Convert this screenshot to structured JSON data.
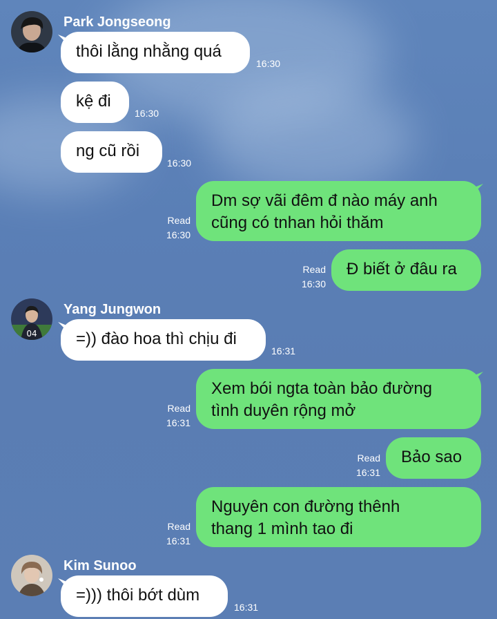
{
  "messages": [
    {
      "type": "in",
      "sender": "Park Jongseong",
      "text": "thôi lằng nhằng quá",
      "time": "16:30"
    },
    {
      "type": "in",
      "text": "kệ đi",
      "time": "16:30"
    },
    {
      "type": "in",
      "text": "ng cũ rồi",
      "time": "16:30"
    },
    {
      "type": "out",
      "lines": [
        "Dm sợ vãi đêm đ nào máy anh",
        "cũng có tnhan hỏi thăm"
      ],
      "read": "Read",
      "time": "16:30"
    },
    {
      "type": "out",
      "lines": [
        "Đ biết ở đâu ra"
      ],
      "read": "Read",
      "time": "16:30"
    },
    {
      "type": "in",
      "sender": "Yang Jungwon",
      "text": "=)) đào hoa thì chịu đi",
      "time": "16:31"
    },
    {
      "type": "out",
      "lines": [
        "Xem bói ngta toàn bảo đường",
        "tình duyên rộng mở"
      ],
      "read": "Read",
      "time": "16:31"
    },
    {
      "type": "out",
      "lines": [
        "Bảo sao"
      ],
      "read": "Read",
      "time": "16:31"
    },
    {
      "type": "out",
      "lines": [
        "Nguyên con đường thênh",
        "thang 1 mình tao đi"
      ],
      "read": "Read",
      "time": "16:31"
    },
    {
      "type": "in",
      "sender": "Kim Sunoo",
      "text": "=))) thôi bớt dùm",
      "time": "16:31"
    }
  ],
  "colors": {
    "background": "#5a7fb6",
    "outgoing_bubble": "#6fe37b",
    "incoming_bubble": "#ffffff"
  }
}
